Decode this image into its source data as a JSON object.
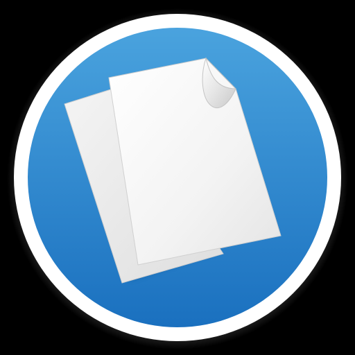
{
  "icon": {
    "name": "documents-app-icon",
    "colors": {
      "background": "#000000",
      "ring": "#ffffff",
      "disc_top": "#4aa3de",
      "disc_bottom": "#1a70bf",
      "paper": "#f2f2f2",
      "paper_shade": "#d9d9d9"
    }
  }
}
